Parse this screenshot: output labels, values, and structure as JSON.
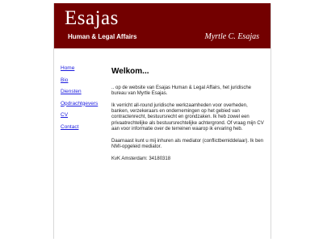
{
  "header": {
    "logo": "Esajas",
    "tagline": "Human & Legal Affairs",
    "owner": "Myrtle C. Esajas"
  },
  "nav": {
    "items": [
      {
        "label": "Home"
      },
      {
        "label": "Bio"
      },
      {
        "label": "Diensten"
      },
      {
        "label": "Opdrachtgevers"
      },
      {
        "label": "CV"
      },
      {
        "label": "Contact"
      }
    ]
  },
  "content": {
    "heading": "Welkom...",
    "paragraphs": [
      ".. op de website van Esajas Human & Legal Affairs, het juridische bureau van Myrtle Esajas.",
      "Ik verricht all-round juridische werkzaamheden voor overheden, banken, verzekeraars en ondernemingen op het gebied van contractenrecht, bestuursrecht en grondzaken. Ik heb zowel een privaatrechtelijke als bestuursrechtelijke achtergrond. Of vraag mijn CV aan voor informatie over de terreinen waarop ik ervaring heb.",
      "Daarnaast kunt u mij inhuren als mediator (conflictbemiddelaar). Ik ben NMI-opgeleid mediator.",
      "KvK Amsterdam: 34180318"
    ]
  },
  "colors": {
    "header_bg": "#730000",
    "link": "#1a1adf"
  }
}
